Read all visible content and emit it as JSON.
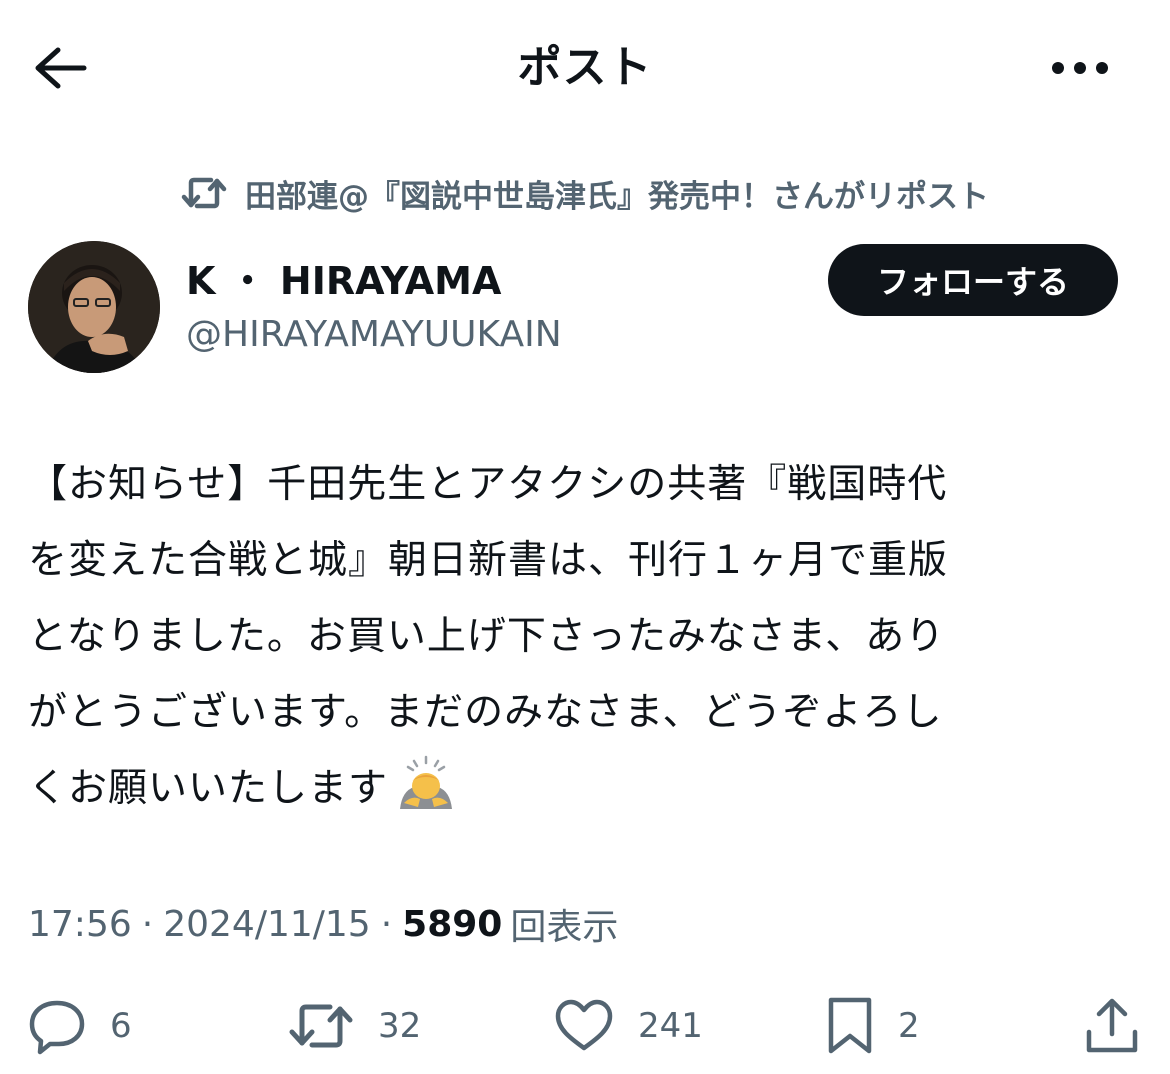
{
  "header": {
    "title": "ポスト",
    "back_icon": "arrow-left-icon",
    "more_icon": "more-horizontal-icon"
  },
  "repost": {
    "icon": "repost-icon",
    "text": "田部連@『図説中世島津氏』発売中！さんがリポスト"
  },
  "author": {
    "name": "K ・ HIRAYAMA",
    "handle": "@HIRAYAMAYUUKAIN",
    "follow_label": "フォローする"
  },
  "tweet": {
    "lines": [
      "【お知らせ】千田先生とアタクシの共著『戦国時代",
      "を変えた合戦と城』朝日新書は、刊行１ヶ月で重版",
      "となりました。お買い上げ下さったみなさま、あり",
      "がとうございます。まだのみなさま、どうぞよろし",
      "くお願いいたします"
    ],
    "emoji": "bowing-person-emoji"
  },
  "meta": {
    "time": "17:56",
    "date": "2024/11/15",
    "separator": "·",
    "views_count": "5890",
    "views_label": "回表示"
  },
  "actions": {
    "replies": "6",
    "reposts": "32",
    "likes": "241",
    "bookmarks": "2"
  },
  "colors": {
    "text_primary": "#0f1419",
    "text_secondary": "#536471",
    "follow_button_bg": "#0f1419",
    "background": "#ffffff"
  }
}
